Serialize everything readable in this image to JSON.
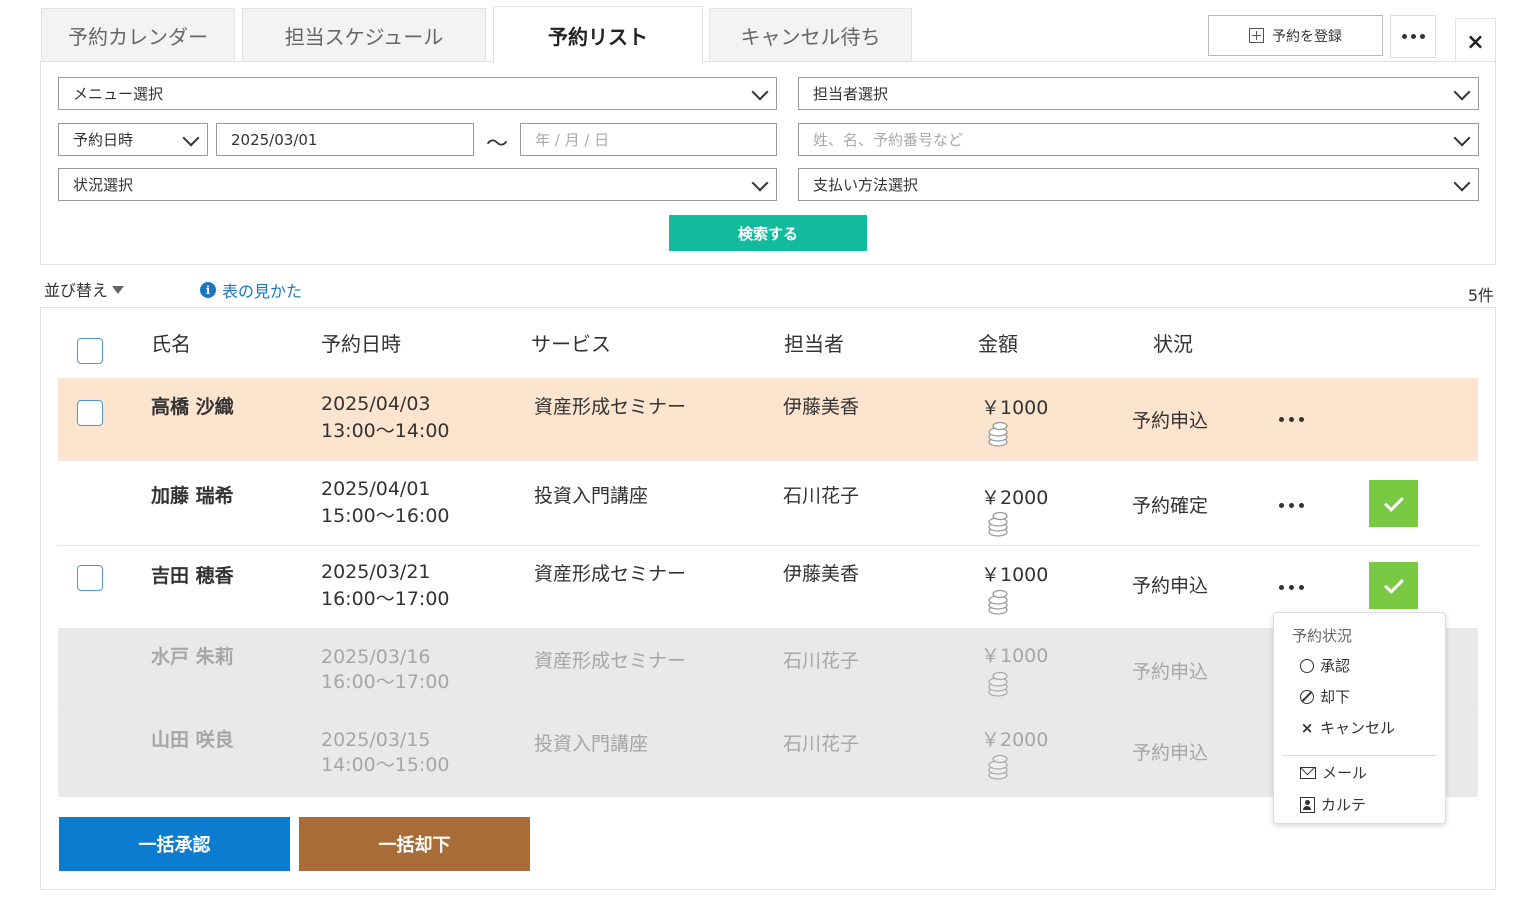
{
  "tabs": [
    {
      "label": "予約カレンダー",
      "active": false
    },
    {
      "label": "担当スケジュール",
      "active": false
    },
    {
      "label": "予約リスト",
      "active": true
    },
    {
      "label": "キャンセル待ち",
      "active": false
    }
  ],
  "header": {
    "register_label": "予約を登録",
    "close_label": "×"
  },
  "filters": {
    "menu_select": "メニュー選択",
    "staff_select": "担当者選択",
    "date_type": "予約日時",
    "date_from": "2025/03/01",
    "range_sep": "～",
    "date_to_placeholder": "年 / 月 / 日",
    "keyword_placeholder": "姓、名、予約番号など",
    "status_select": "状況選択",
    "payment_select": "支払い方法選択",
    "search_label": "検索する"
  },
  "toolbar": {
    "sort_label": "並び替え",
    "howto_label": "表の見かた",
    "info_glyph": "i",
    "count": "5件"
  },
  "table": {
    "headers": {
      "name": "氏名",
      "datetime": "予約日時",
      "service": "サービス",
      "staff": "担当者",
      "amount": "金額",
      "status": "状況"
    },
    "rows": [
      {
        "name": "高橋 沙織",
        "date": "2025/04/03",
        "time": "13:00～14:00",
        "service": "資産形成セミナー",
        "staff": "伊藤美香",
        "amount": "￥1000",
        "status": "予約申込",
        "state": "highlight"
      },
      {
        "name": "加藤 瑞希",
        "date": "2025/04/01",
        "time": "15:00～16:00",
        "service": "投資入門講座",
        "staff": "石川花子",
        "amount": "￥2000",
        "status": "予約確定",
        "state": "normal"
      },
      {
        "name": "吉田 穂香",
        "date": "2025/03/21",
        "time": "16:00～17:00",
        "service": "資産形成セミナー",
        "staff": "伊藤美香",
        "amount": "￥1000",
        "status": "予約申込",
        "state": "normal"
      },
      {
        "name": "水戸 朱莉",
        "date": "2025/03/16",
        "time": "16:00～17:00",
        "service": "資産形成セミナー",
        "staff": "石川花子",
        "amount": "￥1000",
        "status": "予約申込",
        "state": "disabled"
      },
      {
        "name": "山田 咲良",
        "date": "2025/03/15",
        "time": "14:00～15:00",
        "service": "投資入門講座",
        "staff": "石川花子",
        "amount": "￥2000",
        "status": "予約申込",
        "state": "disabled"
      }
    ]
  },
  "context_menu": {
    "title": "予約状況",
    "approve": "承認",
    "reject": "却下",
    "cancel": "キャンセル",
    "mail": "メール",
    "karte": "カルテ"
  },
  "bulk": {
    "approve_label": "一括承認",
    "reject_label": "一括却下"
  },
  "colors": {
    "accent_teal": "#11bb9b",
    "approve_blue": "#0c7cd0",
    "reject_brown": "#a86d37",
    "confirm_green": "#7ac943",
    "highlight_row": "#fde4cf"
  }
}
